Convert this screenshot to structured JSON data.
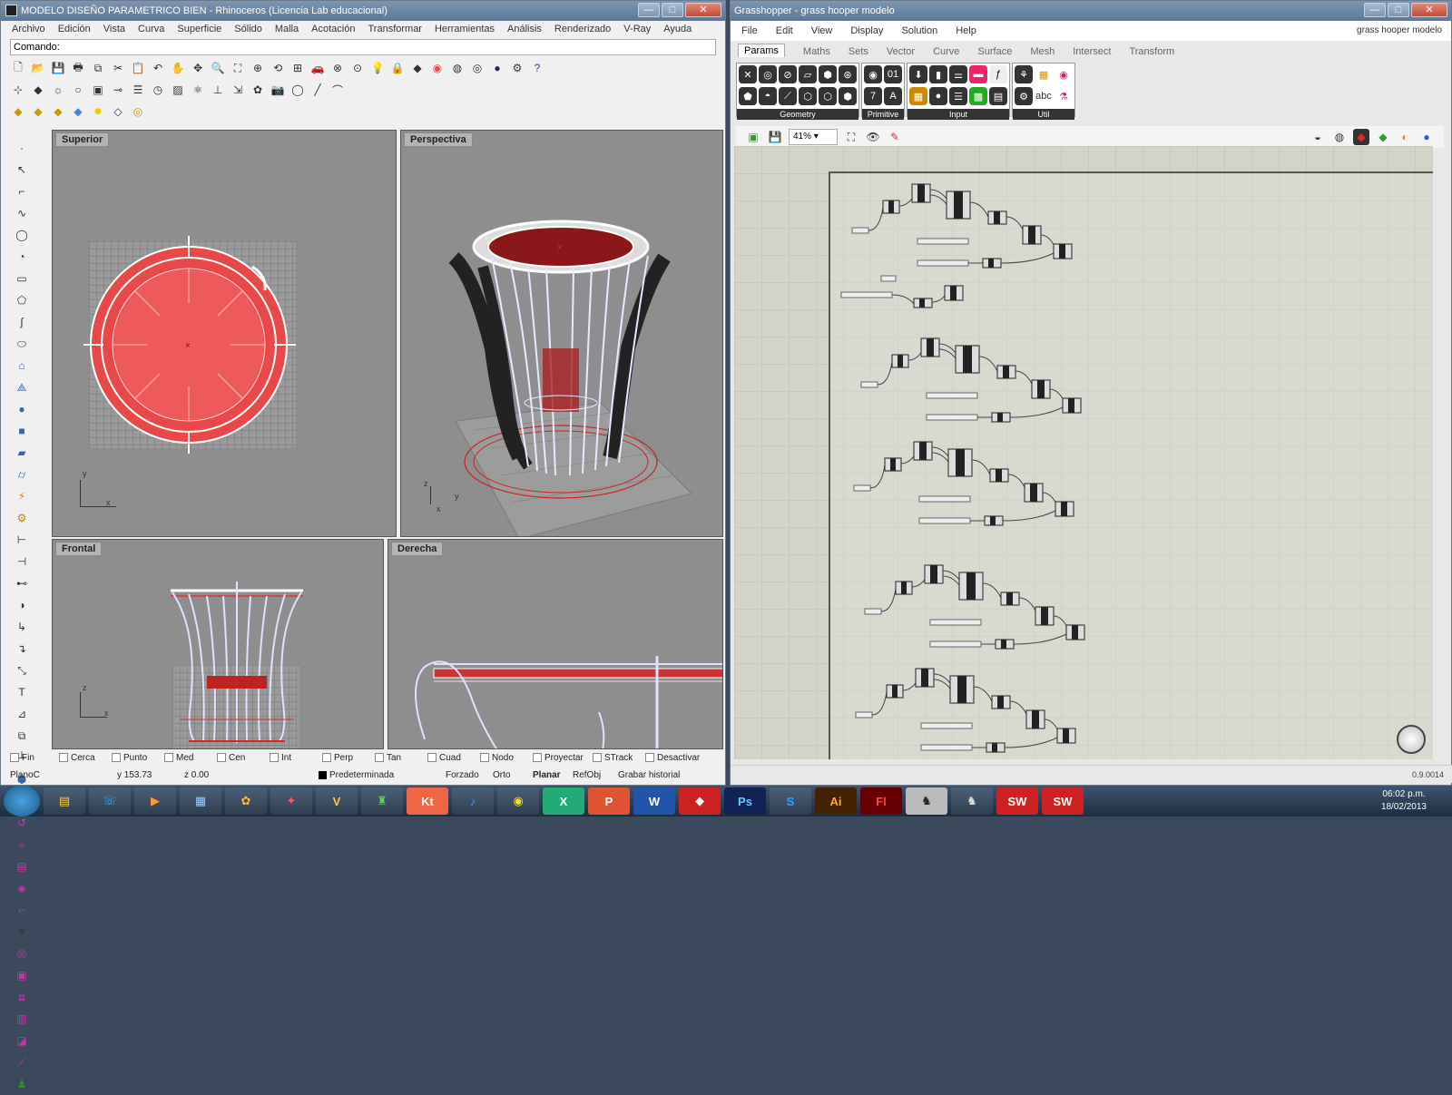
{
  "rhino": {
    "title": "MODELO DISEÑO PARAMETRICO BIEN - Rhinoceros (Licencia Lab educacional)",
    "menu": [
      "Archivo",
      "Edición",
      "Vista",
      "Curva",
      "Superficie",
      "Sólido",
      "Malla",
      "Acotación",
      "Transformar",
      "Herramientas",
      "Análisis",
      "Renderizado",
      "V-Ray",
      "Ayuda"
    ],
    "command_label": "Comando:",
    "viewports": {
      "top": "Superior",
      "perspective": "Perspectiva",
      "front": "Frontal",
      "right": "Derecha"
    },
    "osnaps": [
      "Fin",
      "Cerca",
      "Punto",
      "Med",
      "Cen",
      "Int",
      "Perp",
      "Tan",
      "Cuad",
      "Nodo",
      "Proyectar",
      "STrack",
      "Desactivar"
    ],
    "status": {
      "cplane": "PlanoC",
      "y": "y 153.73",
      "z": "z 0.00",
      "layer": "Predeterminada",
      "forzado": "Forzado",
      "orto": "Orto",
      "planar": "Planar",
      "refobj": "RefObj",
      "history": "Grabar historial"
    },
    "axis_labels": {
      "x": "x",
      "y": "y",
      "z": "z"
    }
  },
  "grasshopper": {
    "title": "Grasshopper - grass hooper modelo",
    "menu": [
      "File",
      "Edit",
      "View",
      "Display",
      "Solution",
      "Help"
    ],
    "doc_name": "grass hooper modelo",
    "tabs": [
      "Params",
      "Maths",
      "Sets",
      "Vector",
      "Curve",
      "Surface",
      "Mesh",
      "Intersect",
      "Transform"
    ],
    "groups": [
      "Geometry",
      "Primitive",
      "Input",
      "Util"
    ],
    "zoom": "41%",
    "version": "0.9.0014"
  },
  "taskbar": {
    "apps": [
      "",
      "",
      "",
      "",
      "",
      "",
      "",
      "",
      "",
      "Kt",
      "",
      "",
      "",
      "",
      "W",
      "",
      "Ps",
      "",
      "Ai",
      "Fl",
      "",
      "",
      "SW",
      "SW"
    ],
    "time": "06:02 p.m.",
    "date": "18/02/2013"
  },
  "colors": {
    "accent_red": "#e84040",
    "wire": "#e8e8ff",
    "titlebar": "#6b86a6"
  }
}
